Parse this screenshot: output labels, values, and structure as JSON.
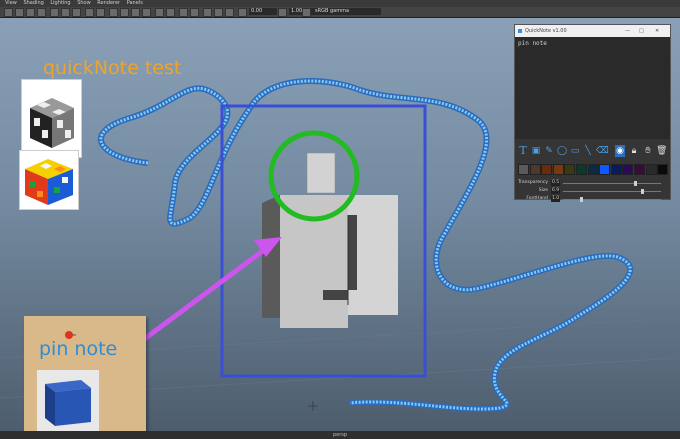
{
  "menu": [
    "View",
    "Shading",
    "Lighting",
    "Show",
    "Renderer",
    "Panels"
  ],
  "toolbar": {
    "field1": "0.00",
    "field2": "1.00",
    "colorspace": "sRGB gamma"
  },
  "viewport": {
    "note_title": "quickNote test",
    "camera_label": "persp"
  },
  "pin_note": {
    "label": "pin note"
  },
  "quicknote": {
    "title": "QuickNote v1.00",
    "canvas_text": "pin note",
    "colors": [
      "#5a5a5a",
      "#4a3a2a",
      "#6a2a10",
      "#7a3a10",
      "#3a3a10",
      "#0a3a2a",
      "#0a2a4a",
      "#0a5aff",
      "#0a1a5a",
      "#2a0a5a",
      "#3a0a3a",
      "#2a2a2a",
      "#0a0a0a"
    ],
    "sliders": [
      {
        "label": "Transparency",
        "value": "0.5",
        "level": 0.75
      },
      {
        "label": "Size",
        "value": "6.9",
        "level": 0.82
      },
      {
        "label": "FontHand",
        "value": "1.0",
        "level": 0.18
      }
    ],
    "tools": [
      "text-tool",
      "pin-tool",
      "pen-tool",
      "ellipse-tool",
      "rectangle-tool",
      "line-tool",
      "eraser-tool"
    ],
    "view_tools": [
      "view-icon",
      "lock-icon",
      "hand-icon",
      "trash-icon"
    ]
  },
  "colors": {
    "annotation_arrow": "#cc55ee",
    "circle": "#22bb22",
    "bbox": "#3a4fd6",
    "curve": "#4fb2ff"
  }
}
